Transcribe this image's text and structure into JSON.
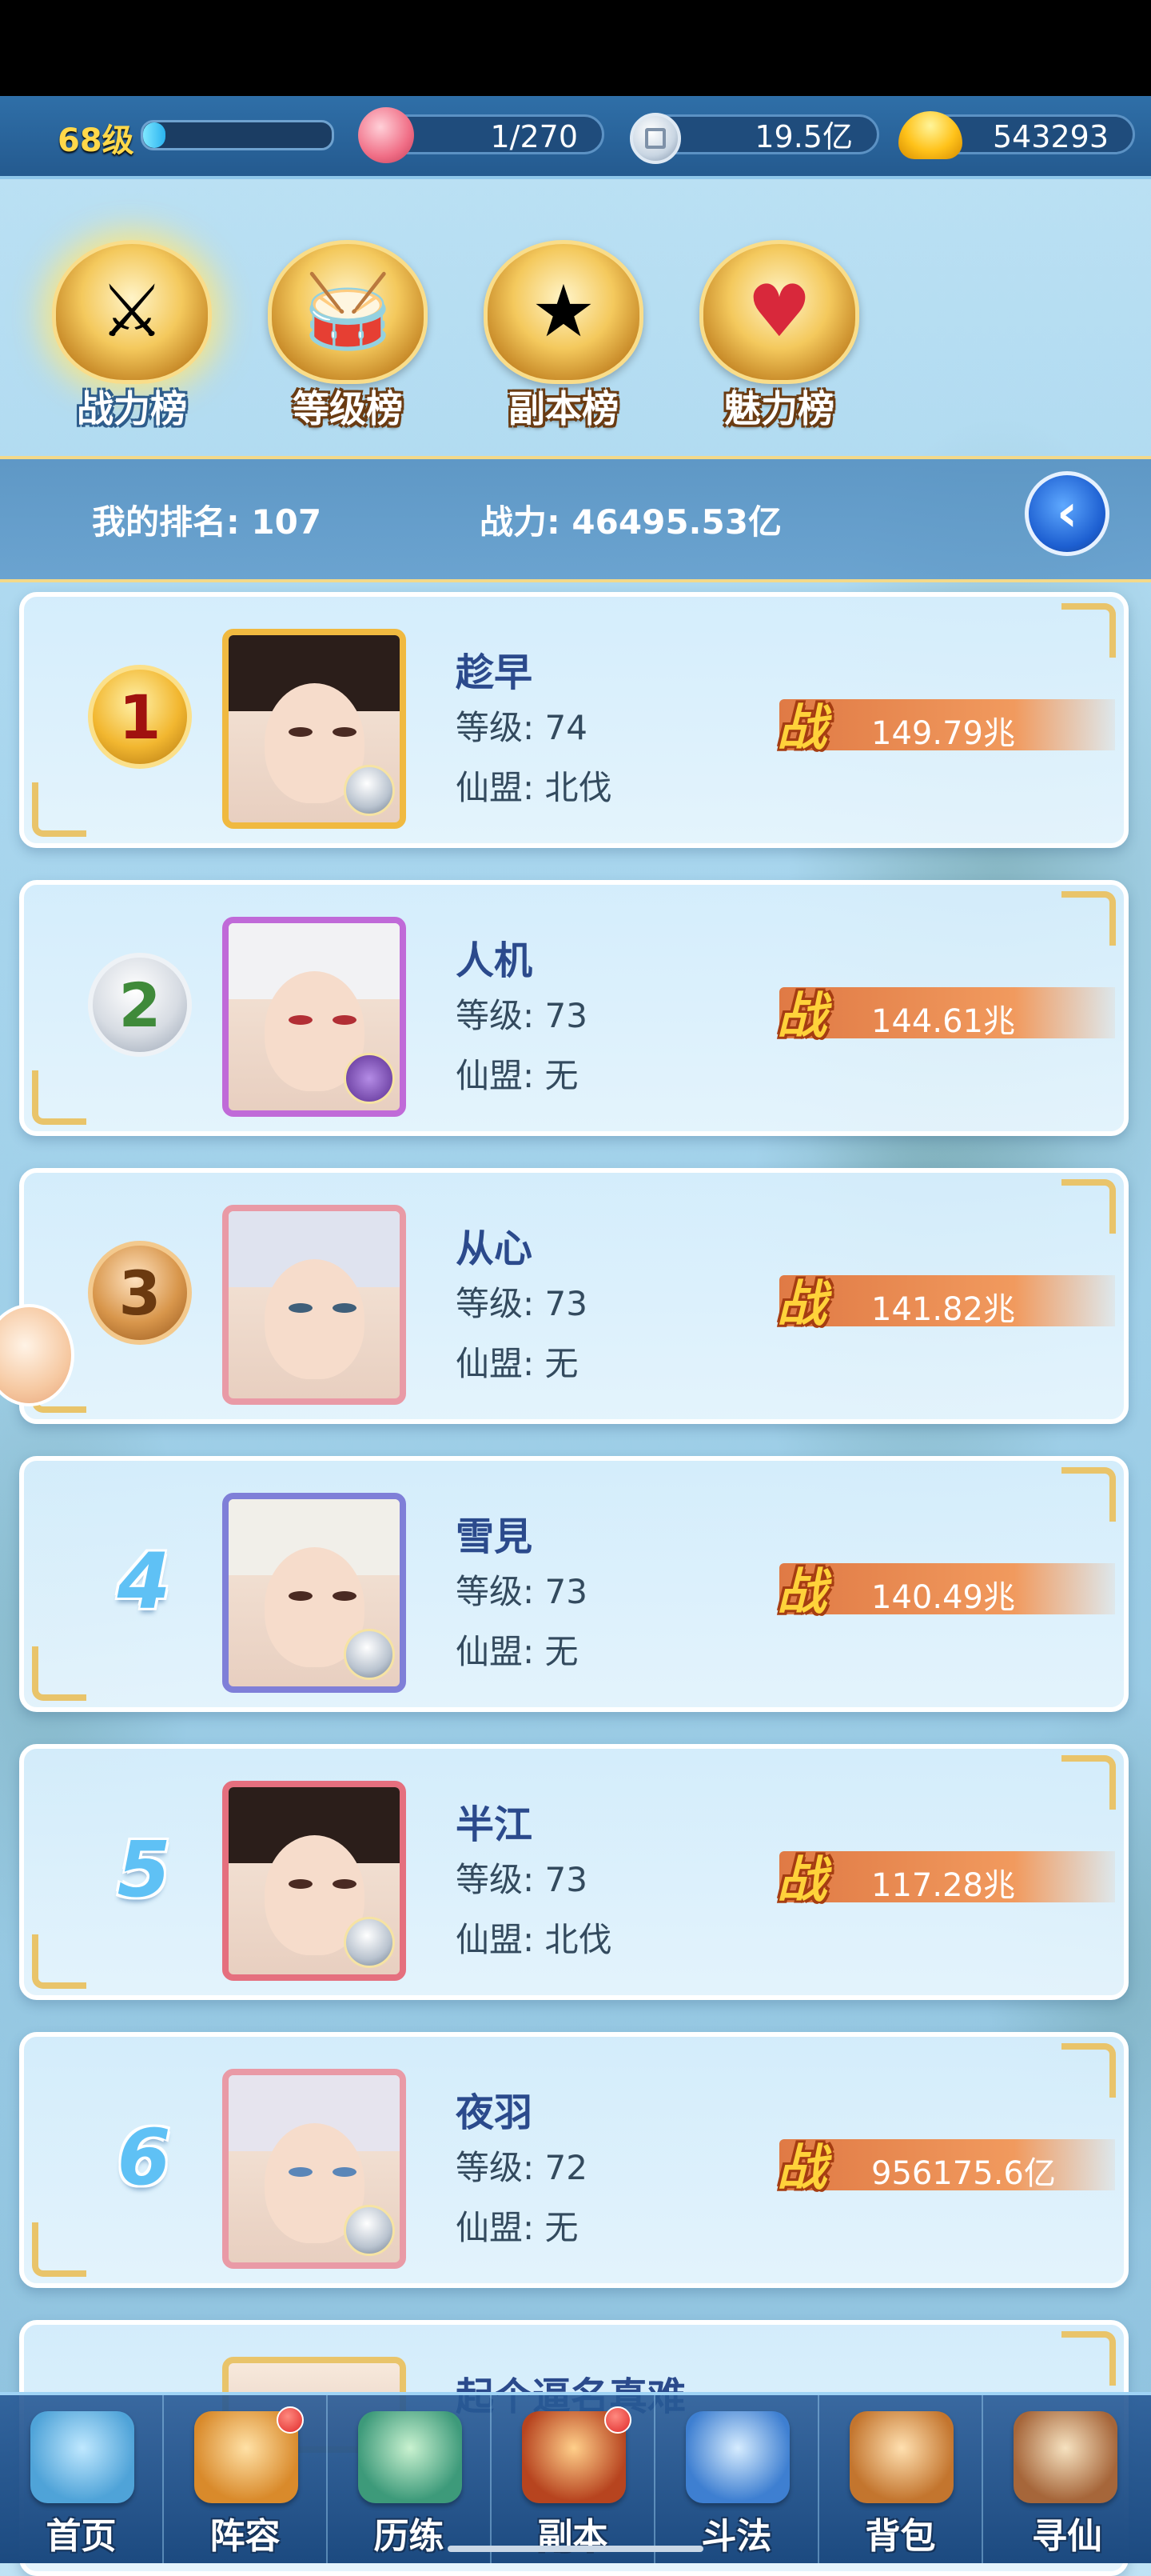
{
  "top_bar": {
    "level": "68级",
    "xp_progress": 0.12,
    "stamina": "1/270",
    "silver": "19.5亿",
    "gold": "543293"
  },
  "tabs": [
    {
      "label": "战力榜",
      "icon": "sword-emblem-icon",
      "active": true
    },
    {
      "label": "等级榜",
      "icon": "drum-emblem-icon",
      "active": false
    },
    {
      "label": "副本榜",
      "icon": "stars-emblem-icon",
      "active": false
    },
    {
      "label": "魅力榜",
      "icon": "heart-emblem-icon",
      "active": false
    }
  ],
  "my_rank": {
    "rank_text": "我的排名: 107",
    "power_text": "战力: 46495.53亿"
  },
  "rows": [
    {
      "rank": "1",
      "name": "趁早",
      "level": "等级: 74",
      "guild": "仙盟: 北伐",
      "power": "149.79兆",
      "power_icon": "战"
    },
    {
      "rank": "2",
      "name": "人机",
      "level": "等级: 73",
      "guild": "仙盟: 无",
      "power": "144.61兆",
      "power_icon": "战"
    },
    {
      "rank": "3",
      "name": "从心",
      "level": "等级: 73",
      "guild": "仙盟: 无",
      "power": "141.82兆",
      "power_icon": "战"
    },
    {
      "rank": "4",
      "name": "雪見",
      "level": "等级: 73",
      "guild": "仙盟: 无",
      "power": "140.49兆",
      "power_icon": "战"
    },
    {
      "rank": "5",
      "name": "半江",
      "level": "等级: 73",
      "guild": "仙盟: 北伐",
      "power": "117.28兆",
      "power_icon": "战"
    },
    {
      "rank": "6",
      "name": "夜羽",
      "level": "等级: 72",
      "guild": "仙盟: 无",
      "power": "956175.6亿",
      "power_icon": "战"
    }
  ],
  "partial_row": {
    "name": "起个逼名真难"
  },
  "bottom_nav": [
    {
      "label": "首页",
      "icon": "home-island-icon",
      "badge": false
    },
    {
      "label": "阵容",
      "icon": "lineup-cards-icon",
      "badge": true
    },
    {
      "label": "历练",
      "icon": "training-gourd-icon",
      "badge": false
    },
    {
      "label": "副本",
      "icon": "dungeon-gate-icon",
      "badge": true
    },
    {
      "label": "斗法",
      "icon": "battle-crest-icon",
      "badge": false
    },
    {
      "label": "背包",
      "icon": "backpack-icon",
      "badge": false
    },
    {
      "label": "寻仙",
      "icon": "scroll-search-icon",
      "badge": false
    }
  ],
  "colors": {
    "accent_gold": "#f0b940",
    "name_blue": "#2b4a8c",
    "power_orange": "#e07a45",
    "top_bar_blue": "#2f6fa8"
  }
}
